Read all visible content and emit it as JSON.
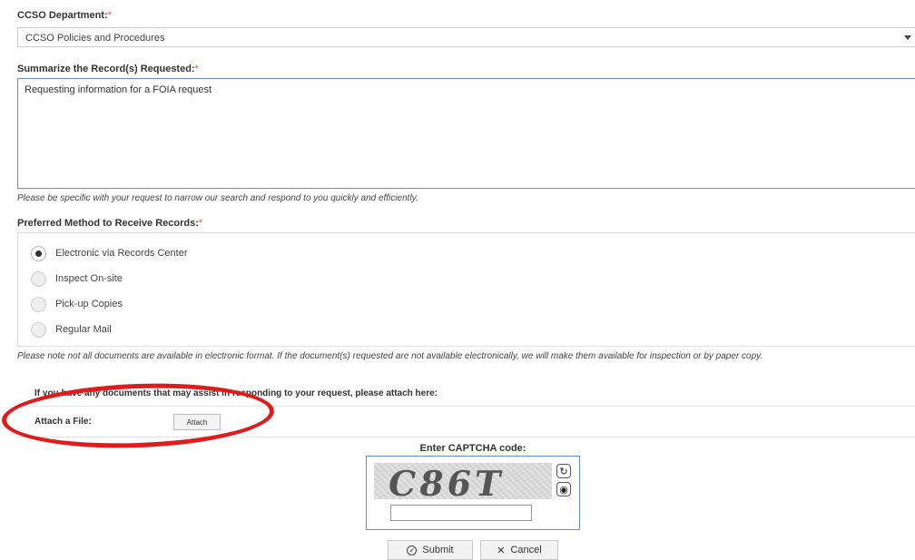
{
  "department": {
    "label": "CCSO Department:",
    "required_mark": "*",
    "selected": "CCSO Policies and Procedures"
  },
  "summary": {
    "label": "Summarize the Record(s) Requested:",
    "required_mark": "*",
    "value": "Requesting information for a FOIA request",
    "help": "Please be specific with your request to narrow our search and respond to you quickly and efficiently."
  },
  "method": {
    "label": "Preferred Method to Receive Records:",
    "required_mark": "*",
    "options": [
      {
        "label": "Electronic via Records Center",
        "checked": true
      },
      {
        "label": "Inspect On-site",
        "checked": false
      },
      {
        "label": "Pick-up Copies",
        "checked": false
      },
      {
        "label": "Regular Mail",
        "checked": false
      }
    ],
    "help": "Please note not all documents are available in electronic format. If the document(s) requested are not available electronically, we will make them available for inspection or by paper copy."
  },
  "attachments": {
    "prompt": "If you have any documents that may assist in responding to your request, please attach here:",
    "file_label": "Attach a File:",
    "attach_button": "Attach"
  },
  "captcha": {
    "label": "Enter CAPTCHA code:",
    "image_text": "C86T",
    "input_value": "",
    "refresh_icon": "refresh-icon",
    "audio_icon": "audio-icon"
  },
  "actions": {
    "submit_label": "Submit",
    "submit_icon": "check-circle-icon",
    "cancel_label": "Cancel",
    "cancel_icon": "x-icon"
  },
  "colors": {
    "required": "#d9534f",
    "annotation_circle": "#e01b1b",
    "focus_border": "#6a8fc7"
  }
}
